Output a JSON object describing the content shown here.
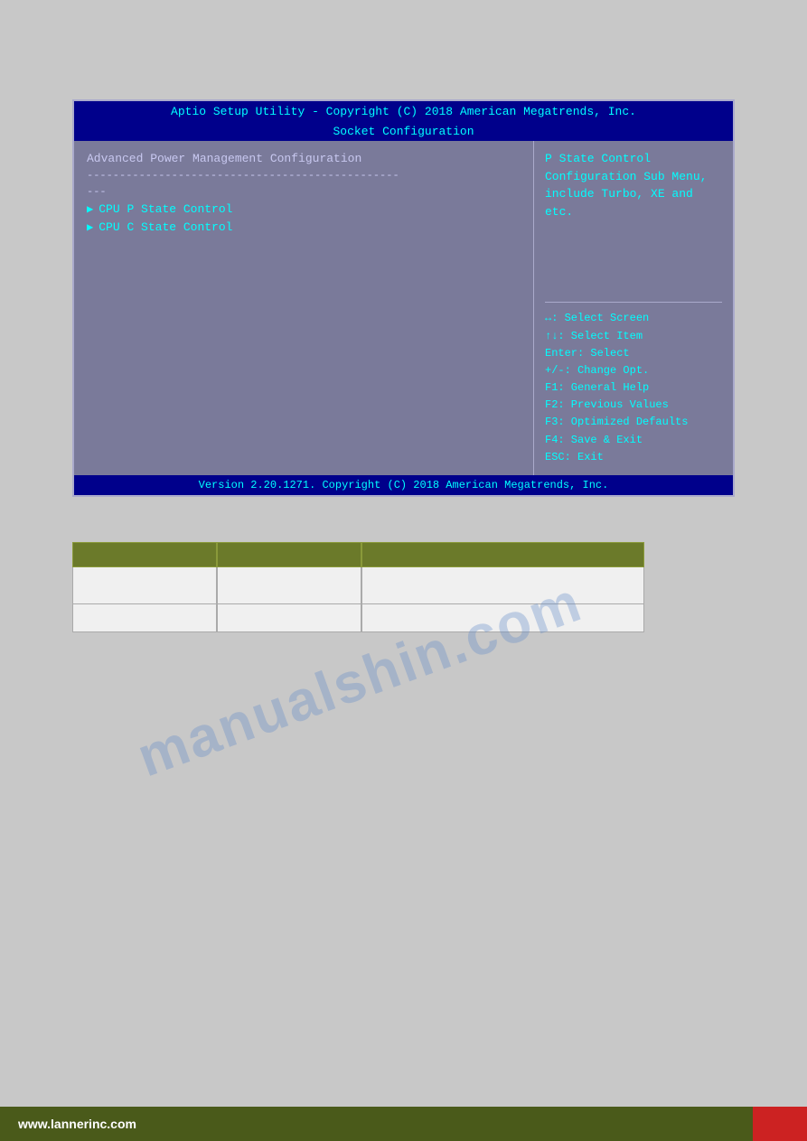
{
  "bios": {
    "title": "Aptio Setup Utility - Copyright (C) 2018 American Megatrends, Inc.",
    "subtitle": "Socket Configuration",
    "left": {
      "section_title": "Advanced Power Management Configuration",
      "separator_line": "------------------------------------------------",
      "dashes": "---",
      "menu_items": [
        {
          "label": "CPU P State Control"
        },
        {
          "label": "CPU C State Control"
        }
      ]
    },
    "right": {
      "help_text_line1": "P State Control",
      "help_text_line2": "Configuration Sub Menu,",
      "help_text_line3": "include Turbo, XE and",
      "help_text_line4": "etc.",
      "keys": [
        "↔: Select Screen",
        "↑↓: Select Item",
        "Enter: Select",
        "+/-: Change Opt.",
        "F1: General Help",
        "F2: Previous Values",
        "F3: Optimized Defaults",
        "F4: Save & Exit",
        "ESC: Exit"
      ]
    },
    "footer": "Version 2.20.1271. Copyright (C) 2018 American Megatrends, Inc."
  },
  "watermark": {
    "text": "manualshin.com"
  },
  "site_footer": {
    "url": "www.lannerinc.com"
  },
  "icons": {
    "arrow_right": "▶"
  }
}
